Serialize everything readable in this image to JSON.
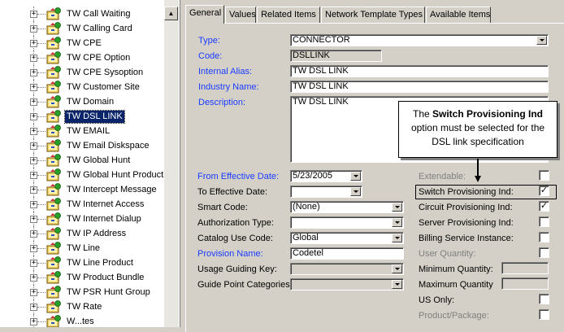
{
  "tree": {
    "items": [
      {
        "label": "TW Call Waiting",
        "selected": false
      },
      {
        "label": "TW Calling Card",
        "selected": false
      },
      {
        "label": "TW CPE",
        "selected": false
      },
      {
        "label": "TW CPE Option",
        "selected": false
      },
      {
        "label": "TW CPE Sysoption",
        "selected": false
      },
      {
        "label": "TW Customer Site",
        "selected": false
      },
      {
        "label": "TW Domain",
        "selected": false
      },
      {
        "label": "TW DSL LINK",
        "selected": true
      },
      {
        "label": "TW EMAIL",
        "selected": false
      },
      {
        "label": "TW Email Diskspace",
        "selected": false
      },
      {
        "label": "TW Global Hunt",
        "selected": false
      },
      {
        "label": "TW Global Hunt Product",
        "selected": false
      },
      {
        "label": "TW Intercept Message",
        "selected": false
      },
      {
        "label": "TW Internet Access",
        "selected": false
      },
      {
        "label": "TW Internet Dialup",
        "selected": false
      },
      {
        "label": "TW IP Address",
        "selected": false
      },
      {
        "label": "TW Line",
        "selected": false
      },
      {
        "label": "TW Line Product",
        "selected": false
      },
      {
        "label": "TW Product Bundle",
        "selected": false
      },
      {
        "label": "TW PSR Hunt Group",
        "selected": false
      },
      {
        "label": "TW Rate",
        "selected": false
      },
      {
        "label": "W...tes",
        "selected": false
      }
    ],
    "expander_symbol": "+",
    "icon": "catalog-item-icon",
    "scroll_up_symbol": "▲"
  },
  "tabs": [
    {
      "label": "General",
      "active": true
    },
    {
      "label": "Values",
      "active": false
    },
    {
      "label": "Related Items",
      "active": false
    },
    {
      "label": "Network Template Types",
      "active": false
    },
    {
      "label": "Available Items",
      "active": false
    }
  ],
  "form": {
    "type_label": "Type:",
    "type_value": "CONNECTOR",
    "code_label": "Code:",
    "code_value": "DSLLINK",
    "internal_alias_label": "Internal Alias:",
    "internal_alias_value": "TW DSL LINK",
    "industry_name_label": "Industry Name:",
    "industry_name_value": "TW DSL LINK",
    "description_label": "Description:",
    "description_value": "TW DSL LINK",
    "from_effective_date_label": "From Effective Date:",
    "from_effective_date_value": "5/23/2005",
    "to_effective_date_label": "To Effective Date:",
    "to_effective_date_value": "",
    "smart_code_label": "Smart Code:",
    "smart_code_value": "(None)",
    "authorization_type_label": "Authorization Type:",
    "authorization_type_value": "",
    "catalog_use_code_label": "Catalog Use Code:",
    "catalog_use_code_value": "Global",
    "provision_name_label": "Provision Name:",
    "provision_name_value": "Codetel",
    "usage_guiding_key_label": "Usage Guiding Key:",
    "usage_guiding_key_value": "",
    "guide_point_categories_label": "Guide Point Categories:",
    "guide_point_categories_value": ""
  },
  "flags": {
    "extendable_label": "Extendable:",
    "extendable_checked": false,
    "switch_provisioning_label": "Switch Provisioning Ind:",
    "switch_provisioning_checked": true,
    "circuit_provisioning_label": "Circuit Provisioning Ind:",
    "circuit_provisioning_checked": true,
    "server_provisioning_label": "Server Provisioning Ind:",
    "server_provisioning_checked": false,
    "billing_service_instance_label": "Billing Service Instance:",
    "billing_service_instance_checked": false,
    "user_quantity_label": "User Quantity:",
    "user_quantity_checked": false,
    "minimum_quantity_label": "Minimum Quantity:",
    "minimum_quantity_value": "",
    "maximum_quantity_label": "Maximum Quantity",
    "maximum_quantity_value": "",
    "us_only_label": "US Only:",
    "us_only_checked": false,
    "product_package_label": "Product/Package:",
    "product_package_checked": false,
    "check_mark": "✓"
  },
  "callout": {
    "prefix": "The ",
    "bold": "Switch Provisioning Ind",
    "suffix": " option must be selected for the DSL link specification"
  },
  "colors": {
    "selection": "#0a246a",
    "label_blue": "#1a3cff",
    "label_gray": "#808080",
    "panel": "#d4d0c8"
  }
}
